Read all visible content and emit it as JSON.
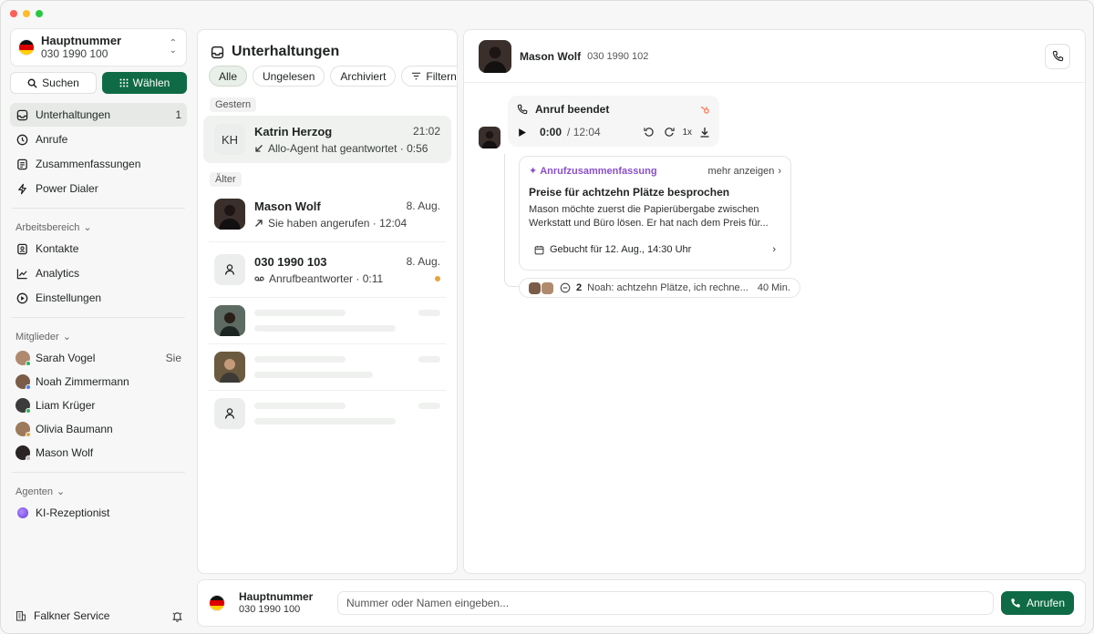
{
  "account": {
    "title": "Hauptnummer",
    "number": "030 1990 100"
  },
  "actions": {
    "search": "Suchen",
    "dial": "Wählen"
  },
  "nav": [
    {
      "label": "Unterhaltungen",
      "count": "1",
      "icon": "inbox-icon"
    },
    {
      "label": "Anrufe",
      "icon": "clock-icon"
    },
    {
      "label": "Zusammenfassungen",
      "icon": "document-icon"
    },
    {
      "label": "Power Dialer",
      "icon": "bolt-icon"
    }
  ],
  "workspace": {
    "label": "Arbeitsbereich",
    "items": [
      {
        "label": "Kontakte",
        "icon": "contacts-icon"
      },
      {
        "label": "Analytics",
        "icon": "chart-icon"
      },
      {
        "label": "Einstellungen",
        "icon": "settings-icon"
      }
    ]
  },
  "members": {
    "label": "Mitglieder",
    "items": [
      {
        "name": "Sarah Vogel",
        "tag": "Sie",
        "status": "#2fb35c",
        "color": "#b08a6e"
      },
      {
        "name": "Noah Zimmermann",
        "tag": "",
        "status": "#4c7ff0",
        "color": "#7a5c48"
      },
      {
        "name": "Liam Krüger",
        "tag": "",
        "status": "#2fb35c",
        "color": "#3b3b3b"
      },
      {
        "name": "Olivia Baumann",
        "tag": "",
        "status": "#e8a33d",
        "color": "#9c7a5b"
      },
      {
        "name": "Mason Wolf",
        "tag": "",
        "status": "#b8bcb8",
        "color": "#2a2424"
      }
    ]
  },
  "agents": {
    "label": "Agenten",
    "items": [
      {
        "name": "KI-Rezeptionist"
      }
    ]
  },
  "footer": {
    "org": "Falkner Service"
  },
  "list": {
    "title": "Unterhaltungen",
    "filters": [
      "Alle",
      "Ungelesen",
      "Archiviert",
      "Filtern"
    ],
    "groups": {
      "yesterday": "Gestern",
      "older": "Älter"
    },
    "conversations": [
      {
        "initials": "KH",
        "name": "Katrin Herzog",
        "time": "21:02",
        "sub": "Allo-Agent hat geantwortet · 0:56"
      },
      {
        "name": "Mason Wolf",
        "time": "8. Aug.",
        "sub": "Sie haben angerufen · 12:04"
      },
      {
        "name": "030 1990 103",
        "time": "8. Aug.",
        "sub": "Anrufbeantworter · 0:11"
      }
    ]
  },
  "detail": {
    "contact": {
      "name": "Mason Wolf",
      "number": "030 1990 102"
    },
    "call": {
      "title": "Anruf beendet",
      "current": "0:00",
      "total": "/ 12:04",
      "speed": "1x"
    },
    "summary": {
      "label": "Anrufzusammenfassung",
      "more": "mehr anzeigen",
      "title": "Preise für achtzehn Plätze besprochen",
      "text": "Mason möchte zuerst die Papierübergabe zwischen Werkstatt und Büro lösen. Er hat nach dem Preis für...",
      "booked": "Gebucht für 12. Aug., 14:30 Uhr"
    },
    "reply": {
      "count": "2",
      "text": "Noah: achtzehn Plätze, ich rechne...",
      "time": "40 Min."
    }
  },
  "bottom": {
    "title": "Hauptnummer",
    "number": "030 1990 100",
    "placeholder": "Nummer oder Namen eingeben...",
    "call": "Anrufen"
  },
  "colors": {
    "accent": "#0f6b45",
    "summary": "#8a4fc8",
    "unread": "#e8a33d"
  }
}
